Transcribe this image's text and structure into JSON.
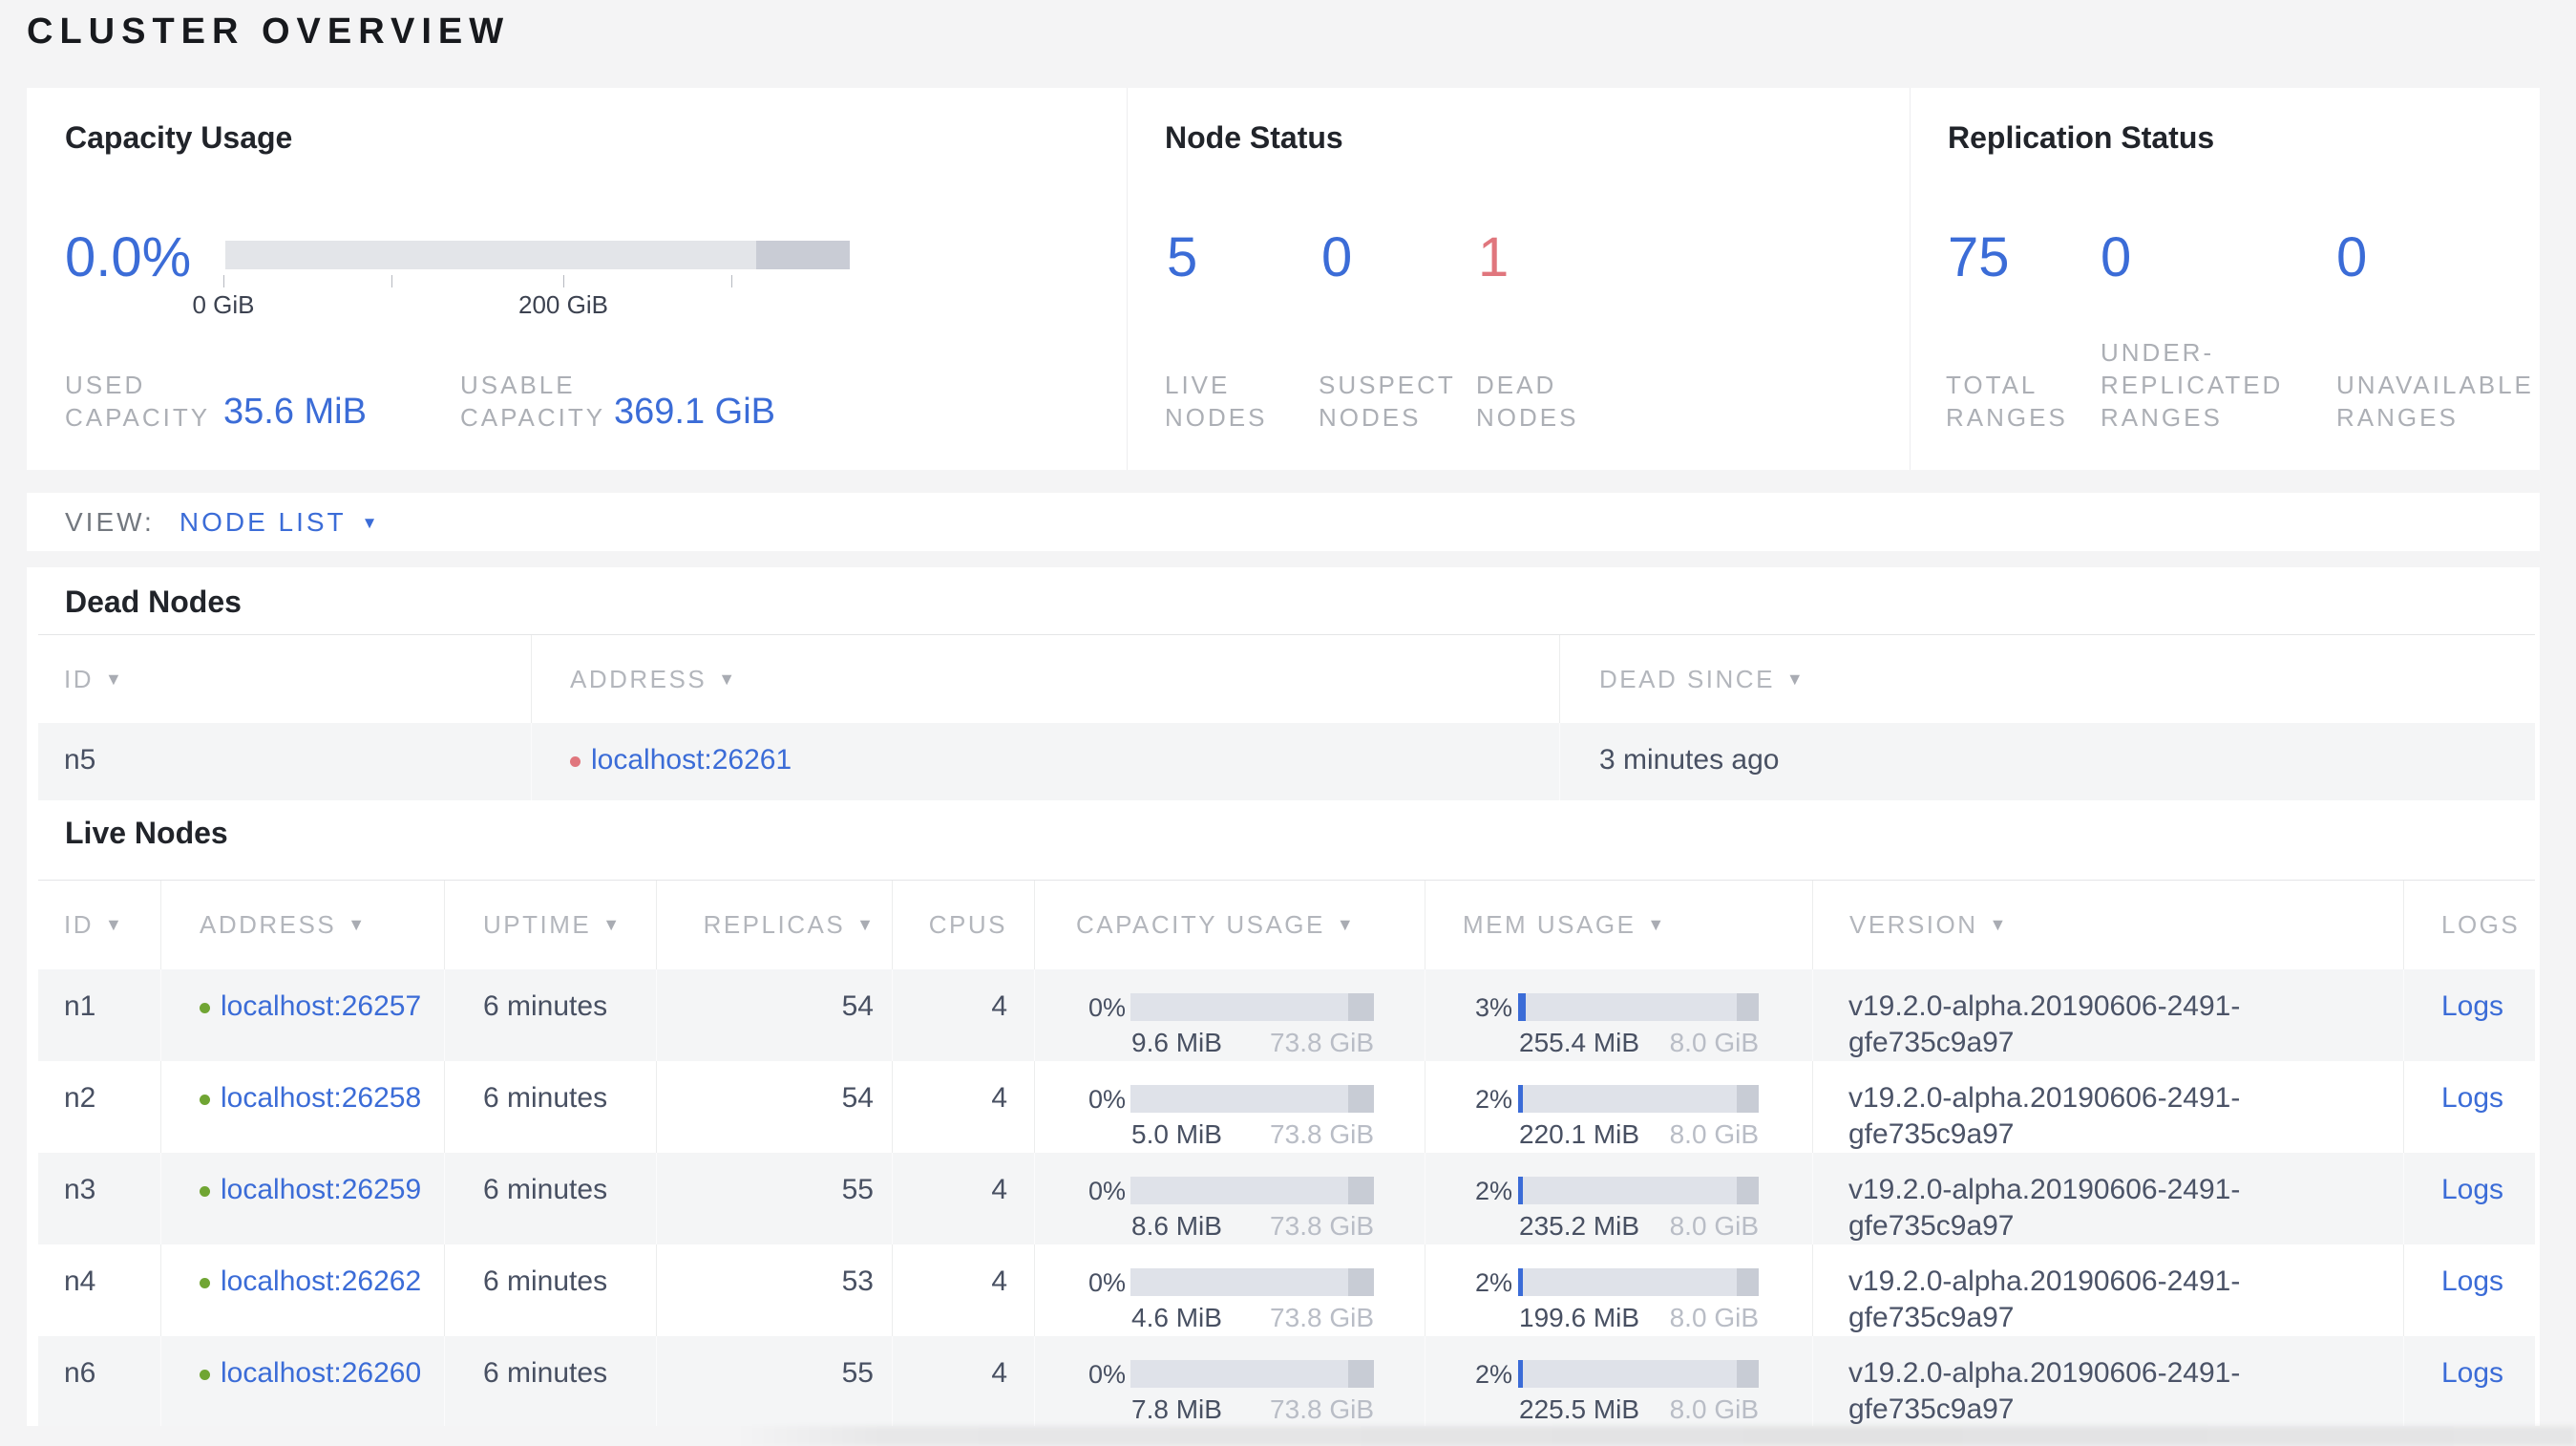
{
  "page": {
    "title": "CLUSTER OVERVIEW"
  },
  "icons": {
    "sort_arrow": "▼",
    "dropdown_caret": "▼"
  },
  "colors": {
    "accent_blue": "#3b6cd7",
    "dead_red": "#e0767d",
    "live_green": "#70a533"
  },
  "overview": {
    "capacity": {
      "title": "Capacity Usage",
      "percent": "0.0%",
      "percent_value": 0,
      "axis": {
        "tick_labels": [
          "0 GiB",
          "200 GiB"
        ]
      },
      "stats": [
        {
          "label_lines": [
            "USED",
            "CAPACITY"
          ],
          "value": "35.6 MiB"
        },
        {
          "label_lines": [
            "USABLE",
            "CAPACITY"
          ],
          "value": "369.1 GiB"
        }
      ]
    },
    "node_status": {
      "title": "Node Status",
      "stats": [
        {
          "value": "5",
          "label_lines": [
            "LIVE",
            "NODES"
          ],
          "status": "live"
        },
        {
          "value": "0",
          "label_lines": [
            "SUSPECT",
            "NODES"
          ],
          "status": "suspect"
        },
        {
          "value": "1",
          "label_lines": [
            "DEAD",
            "NODES"
          ],
          "status": "dead"
        }
      ]
    },
    "replication_status": {
      "title": "Replication Status",
      "stats": [
        {
          "value": "75",
          "label_lines": [
            "TOTAL",
            "RANGES"
          ]
        },
        {
          "value": "0",
          "label_lines": [
            "UNDER-",
            "REPLICATED",
            "RANGES"
          ]
        },
        {
          "value": "0",
          "label_lines": [
            "UNAVAILABLE",
            "RANGES"
          ]
        }
      ]
    }
  },
  "view_bar": {
    "label": "VIEW:",
    "selected": "NODE LIST"
  },
  "dead_nodes": {
    "title": "Dead Nodes",
    "columns": [
      {
        "label": "ID",
        "sortable": true
      },
      {
        "label": "ADDRESS",
        "sortable": true
      },
      {
        "label": "DEAD SINCE",
        "sortable": true
      }
    ],
    "rows": [
      {
        "id": "n5",
        "address": "localhost:26261",
        "dead_since": "3 minutes ago"
      }
    ]
  },
  "live_nodes": {
    "title": "Live Nodes",
    "columns": [
      {
        "label": "ID",
        "sortable": true
      },
      {
        "label": "ADDRESS",
        "sortable": true
      },
      {
        "label": "UPTIME",
        "sortable": true
      },
      {
        "label": "REPLICAS",
        "sortable": true
      },
      {
        "label": "CPUS",
        "sortable": false
      },
      {
        "label": "CAPACITY USAGE",
        "sortable": true
      },
      {
        "label": "MEM USAGE",
        "sortable": true
      },
      {
        "label": "VERSION",
        "sortable": true
      },
      {
        "label": "LOGS",
        "sortable": false
      }
    ],
    "rows": [
      {
        "id": "n1",
        "address": "localhost:26257",
        "uptime": "6 minutes",
        "replicas": "54",
        "cpus": "4",
        "capacity_pct": "0%",
        "capacity_pct_value": 0,
        "capacity_used": "9.6 MiB",
        "capacity_total": "73.8 GiB",
        "mem_pct": "3%",
        "mem_pct_value": 3,
        "mem_used": "255.4 MiB",
        "mem_total": "8.0 GiB",
        "version": "v19.2.0-alpha.20190606-2491-gfe735c9a97",
        "logs_label": "Logs"
      },
      {
        "id": "n2",
        "address": "localhost:26258",
        "uptime": "6 minutes",
        "replicas": "54",
        "cpus": "4",
        "capacity_pct": "0%",
        "capacity_pct_value": 0,
        "capacity_used": "5.0 MiB",
        "capacity_total": "73.8 GiB",
        "mem_pct": "2%",
        "mem_pct_value": 2,
        "mem_used": "220.1 MiB",
        "mem_total": "8.0 GiB",
        "version": "v19.2.0-alpha.20190606-2491-gfe735c9a97",
        "logs_label": "Logs"
      },
      {
        "id": "n3",
        "address": "localhost:26259",
        "uptime": "6 minutes",
        "replicas": "55",
        "cpus": "4",
        "capacity_pct": "0%",
        "capacity_pct_value": 0,
        "capacity_used": "8.6 MiB",
        "capacity_total": "73.8 GiB",
        "mem_pct": "2%",
        "mem_pct_value": 2,
        "mem_used": "235.2 MiB",
        "mem_total": "8.0 GiB",
        "version": "v19.2.0-alpha.20190606-2491-gfe735c9a97",
        "logs_label": "Logs"
      },
      {
        "id": "n4",
        "address": "localhost:26262",
        "uptime": "6 minutes",
        "replicas": "53",
        "cpus": "4",
        "capacity_pct": "0%",
        "capacity_pct_value": 0,
        "capacity_used": "4.6 MiB",
        "capacity_total": "73.8 GiB",
        "mem_pct": "2%",
        "mem_pct_value": 2,
        "mem_used": "199.6 MiB",
        "mem_total": "8.0 GiB",
        "version": "v19.2.0-alpha.20190606-2491-gfe735c9a97",
        "logs_label": "Logs"
      },
      {
        "id": "n6",
        "address": "localhost:26260",
        "uptime": "6 minutes",
        "replicas": "55",
        "cpus": "4",
        "capacity_pct": "0%",
        "capacity_pct_value": 0,
        "capacity_used": "7.8 MiB",
        "capacity_total": "73.8 GiB",
        "mem_pct": "2%",
        "mem_pct_value": 2,
        "mem_used": "225.5 MiB",
        "mem_total": "8.0 GiB",
        "version": "v19.2.0-alpha.20190606-2491-gfe735c9a97",
        "logs_label": "Logs"
      }
    ]
  }
}
